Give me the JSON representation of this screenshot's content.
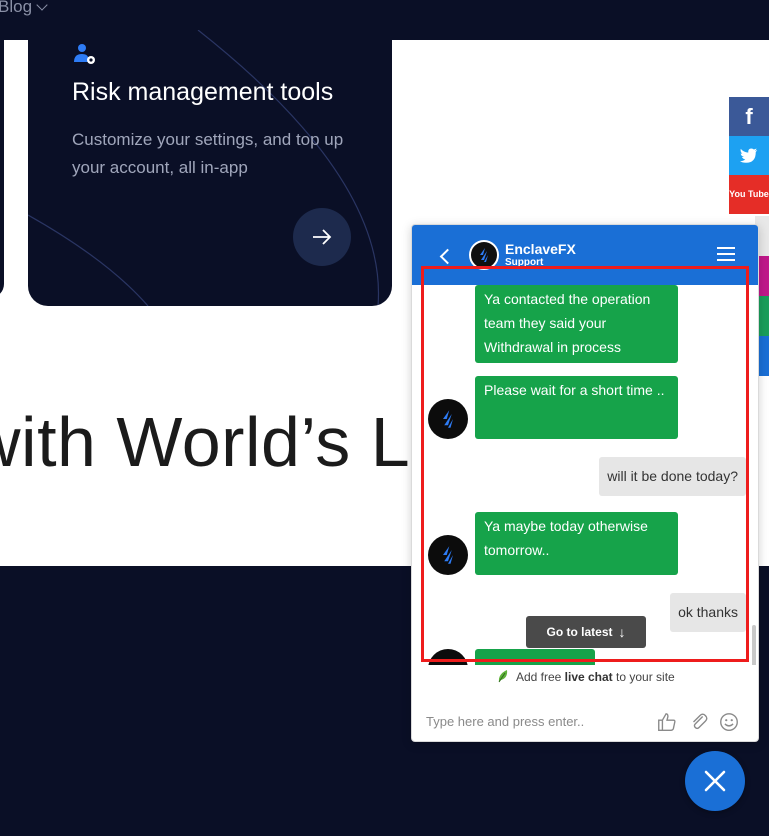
{
  "nav": {
    "blog_label": "Blog"
  },
  "feature_card": {
    "title": "Risk management tools",
    "description": "Customize your settings, and top up your account, all in-app"
  },
  "headline": "with World’s Le",
  "social": {
    "fb": "f",
    "youtube": "You Tube"
  },
  "chat": {
    "agent_name": "EnclaveFX",
    "agent_status": "Support",
    "messages": [
      {
        "from": "agent",
        "text": "Ya contacted the operation team they said your Withdrawal in process"
      },
      {
        "from": "agent",
        "text": "Please wait for a short time .."
      },
      {
        "from": "user",
        "text": "will it be done today?"
      },
      {
        "from": "agent",
        "text": "Ya maybe today otherwise tomorrow.."
      },
      {
        "from": "user",
        "text": "ok thanks"
      }
    ],
    "go_to_latest": "Go to latest",
    "powered_pre": "Add free",
    "powered_bold": "live chat",
    "powered_post": "to your site",
    "input_placeholder": "Type here and press enter.."
  },
  "colors": {
    "site_dark": "#0a0f26",
    "chat_header": "#1a6fd6",
    "agent_bubble": "#16a34a",
    "user_bubble": "#e6e6e6",
    "annotation_red": "#ee1c1c"
  },
  "icons": {
    "back": "chevron-left-icon",
    "menu": "hamburger-menu-icon",
    "like": "thumbs-up-icon",
    "attach": "paperclip-icon",
    "emoji": "smiley-icon",
    "close": "close-icon",
    "arrow": "arrow-right-icon"
  }
}
